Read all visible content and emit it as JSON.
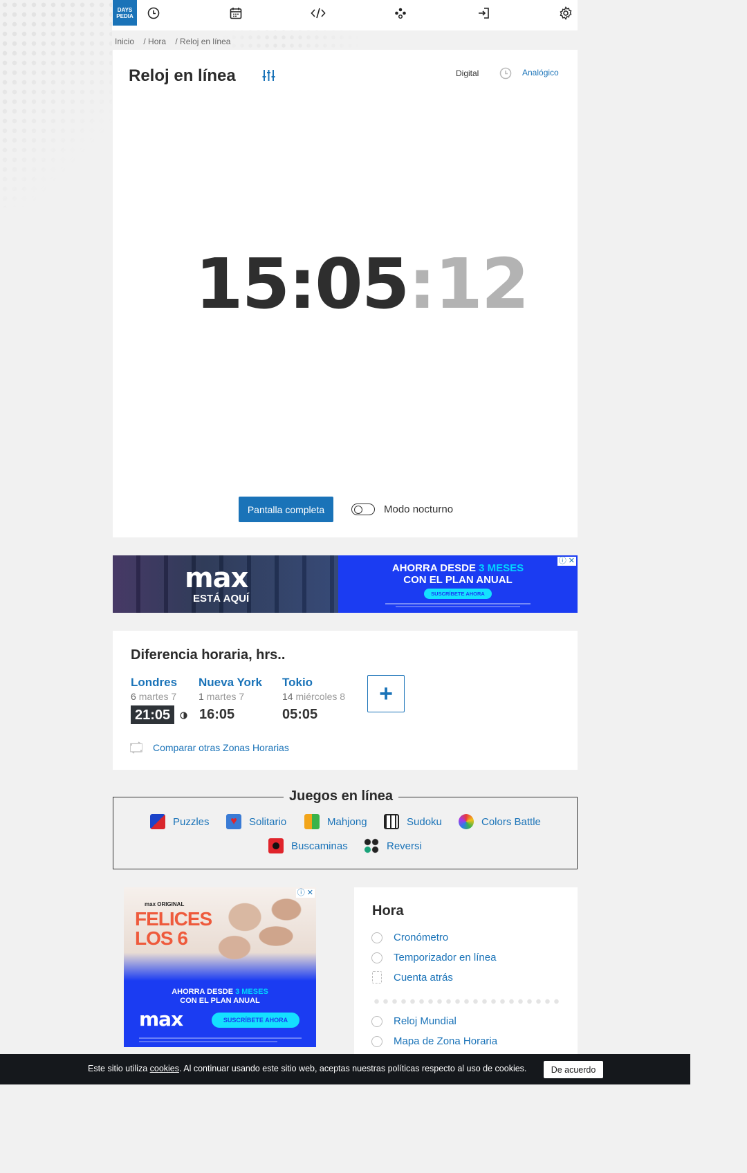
{
  "logo": {
    "line1": "DAYS",
    "line2": "PEDIA"
  },
  "nav": {
    "icons": [
      "clock-icon",
      "calendar-icon",
      "code-icon",
      "games-icon",
      "login-icon",
      "settings-icon"
    ]
  },
  "breadcrumb": [
    "Inicio",
    "/ Hora",
    "/ Reloj en línea"
  ],
  "clock": {
    "title": "Reloj en línea",
    "mode_digital": "Digital",
    "mode_analog": "Analógico",
    "time_hm": "15:05",
    "time_sep": ":",
    "time_sec": "12",
    "fullscreen_label": "Pantalla completa",
    "night_mode_label": "Modo nocturno"
  },
  "ad_banner": {
    "brand": "max",
    "tagline": "ESTÁ AQUÍ",
    "headline_1": "AHORRA DESDE",
    "headline_highlight": "3 MESES",
    "headline_2": "CON EL PLAN ANUAL",
    "cta": "SUSCRÍBETE AHORA"
  },
  "time_diff": {
    "title": "Diferencia horaria, hrs..",
    "cities": [
      {
        "name": "Londres",
        "offset": "6",
        "day": "martes 7",
        "time": "21:05"
      },
      {
        "name": "Nueva York",
        "offset": "1",
        "day": "martes 7",
        "time": "16:05"
      },
      {
        "name": "Tokio",
        "offset": "14",
        "day": "miércoles 8",
        "time": "05:05"
      }
    ],
    "add_label": "+",
    "compare_label": "Comparar otras Zonas Horarias"
  },
  "games": {
    "title": "Juegos en línea",
    "items": [
      "Puzzles",
      "Solitario",
      "Mahjong",
      "Sudoku",
      "Colors Battle",
      "Buscaminas",
      "Reversi"
    ]
  },
  "ad_side": {
    "brand_small": "max ORIGINAL",
    "title_1": "FELICES",
    "title_2": "LOS 6",
    "headline_1": "AHORRA DESDE",
    "headline_highlight": "3 MESES",
    "headline_2": "CON EL PLAN ANUAL",
    "brand": "max",
    "cta": "SUSCRÍBETE AHORA"
  },
  "hora_section": {
    "title": "Hora",
    "links": [
      "Cronómetro",
      "Temporizador en línea",
      "Cuenta atrás",
      "Reloj Mundial",
      "Mapa de Zona Horaria"
    ]
  },
  "cookie": {
    "text_before": "Este sitio utiliza ",
    "link": "cookies",
    "text_after": ". Al continuar usando este sitio web, aceptas nuestras políticas respecto al uso de cookies.",
    "accept": "De acuerdo"
  },
  "colors": {
    "accent": "#1a73b8",
    "ad_blue": "#1b3cf2",
    "dark": "#2e2e2e"
  }
}
